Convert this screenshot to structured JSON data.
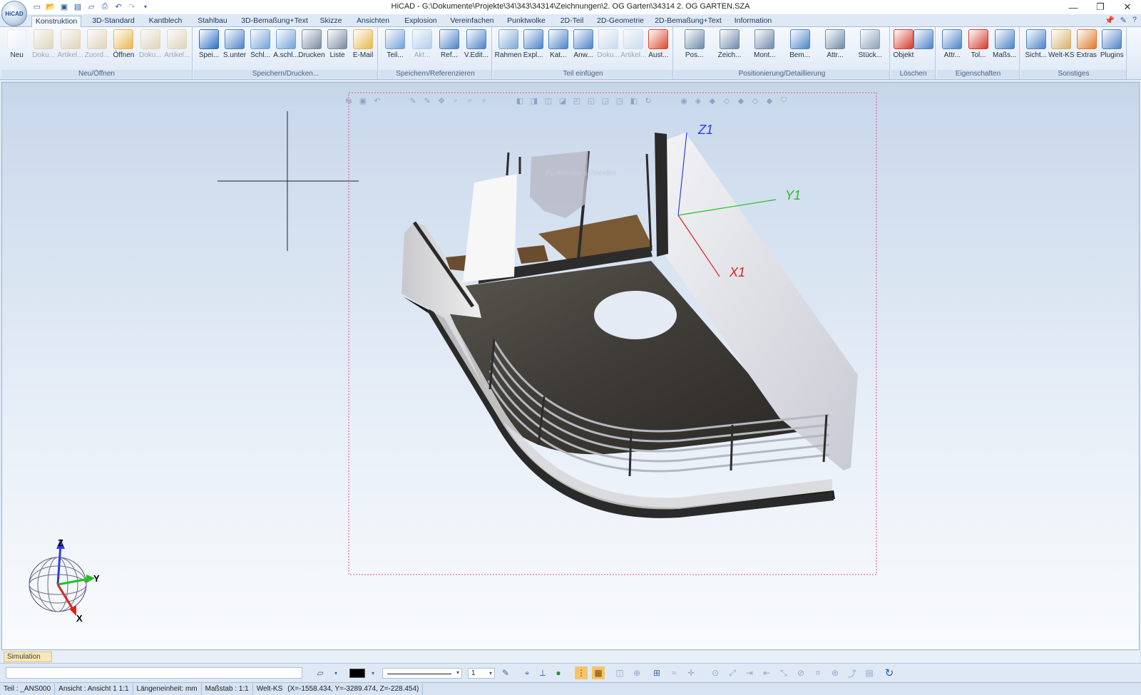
{
  "window": {
    "title": "HiCAD - G:\\Dokumente\\Projekte\\34\\343\\34314\\Zeichnungen\\2. OG Garten\\34314 2. OG GARTEN.SZA",
    "minimize": "—",
    "restore": "❐",
    "close": "✕",
    "orb_label": "HiCAD"
  },
  "ribbon_tabs": [
    "Konstruktion",
    "3D-Standard",
    "Kantblech",
    "Stahlbau",
    "3D-Bemaßung+Text",
    "Skizze",
    "Ansichten",
    "Explosion",
    "Vereinfachen",
    "Punktwolke",
    "2D-Teil",
    "2D-Geometrie",
    "2D-Bemaßung+Text",
    "Information"
  ],
  "ribbon_groups": [
    {
      "label": "Neu/Öffnen",
      "buttons": [
        "Neu",
        "Doku...",
        "Artikel...",
        "Zuord...",
        "Öffnen",
        "Doku...",
        "Artikel..."
      ]
    },
    {
      "label": "Speichern/Drucken...",
      "buttons": [
        "Spei...",
        "S.unter",
        "Schl...",
        "A.schl...",
        "Drucken",
        "Liste",
        "E-Mail"
      ]
    },
    {
      "label": "Speichern/Referenzieren",
      "buttons": [
        "Teil...",
        "Akt...",
        "Ref...",
        "V.Edit..."
      ]
    },
    {
      "label": "Teil einfügen",
      "buttons": [
        "Rahmen",
        "Expl...",
        "Kat...",
        "Anw...",
        "Doku...",
        "Artikel...",
        "Aust..."
      ]
    },
    {
      "label": "Positionierung/Detaillierung",
      "buttons": [
        "Pos...",
        "Zeich...",
        "Mont...",
        "Bem...",
        "Attr...",
        "Stück..."
      ]
    },
    {
      "label": "Löschen",
      "buttons": [
        "Objekt",
        ""
      ]
    },
    {
      "label": "Eigenschaften",
      "buttons": [
        "Attr...",
        "Tol...",
        "Maßs..."
      ]
    },
    {
      "label": "Sonstiges",
      "buttons": [
        "Sicht...",
        "Welt-KS",
        "Extras",
        "Plugins"
      ]
    }
  ],
  "viewport": {
    "axis_labels": {
      "z1": "Z1",
      "y1": "Y1",
      "x1": "X1"
    },
    "triad_labels": {
      "z": "Z",
      "y": "Y",
      "x": "X"
    },
    "ghost_text": "Punktwolke schneiden",
    "colors": {
      "x_axis": "#e02020",
      "y_axis": "#22c022",
      "z_axis": "#2c3ee0",
      "frame": "#e0508c"
    }
  },
  "simulation_tab": "Simulation",
  "cmd_bar": {
    "line_width_value": "1",
    "color_swatch": "#000000"
  },
  "status_bar": {
    "teil": "Teil : _ANS000",
    "ansicht": "Ansicht : Ansicht 1 1:1",
    "laengeneinheit": "Längeneinheit: mm",
    "massstab": "Maßstab : 1:1",
    "welt_ks": "Welt-KS",
    "coords": "(X=-1558.434, Y=-3289.474, Z=-228.454)"
  }
}
